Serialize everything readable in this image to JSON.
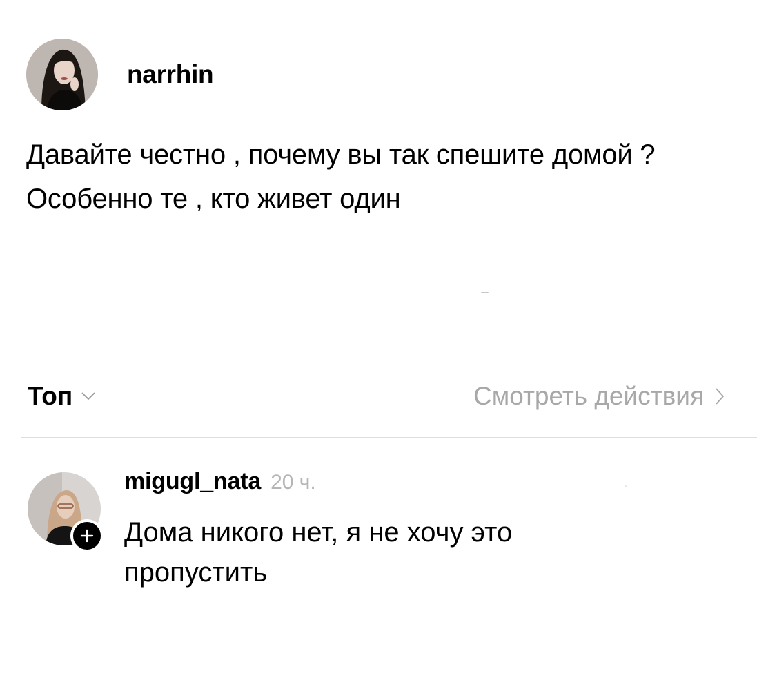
{
  "post": {
    "author": "narrhin",
    "avatar_icon": "profile-photo-icon",
    "text_lines": [
      "Давайте честно , почему вы так спешите домой ?",
      "Особенно те , кто живет один"
    ]
  },
  "sort": {
    "label": "Топ",
    "icon": "chevron-down-icon"
  },
  "activity": {
    "label": "Смотреть действия",
    "icon": "chevron-right-icon"
  },
  "comments": [
    {
      "user": "migugl_nata",
      "time": "20 ч.",
      "text": "Дома никого нет, я не хочу это пропустить",
      "avatar_icon": "profile-photo-icon",
      "badge_icon": "plus-icon"
    }
  ],
  "colors": {
    "text": "#000000",
    "secondary_text": "#a8a8a8",
    "divider": "#dedede",
    "background": "#ffffff"
  }
}
